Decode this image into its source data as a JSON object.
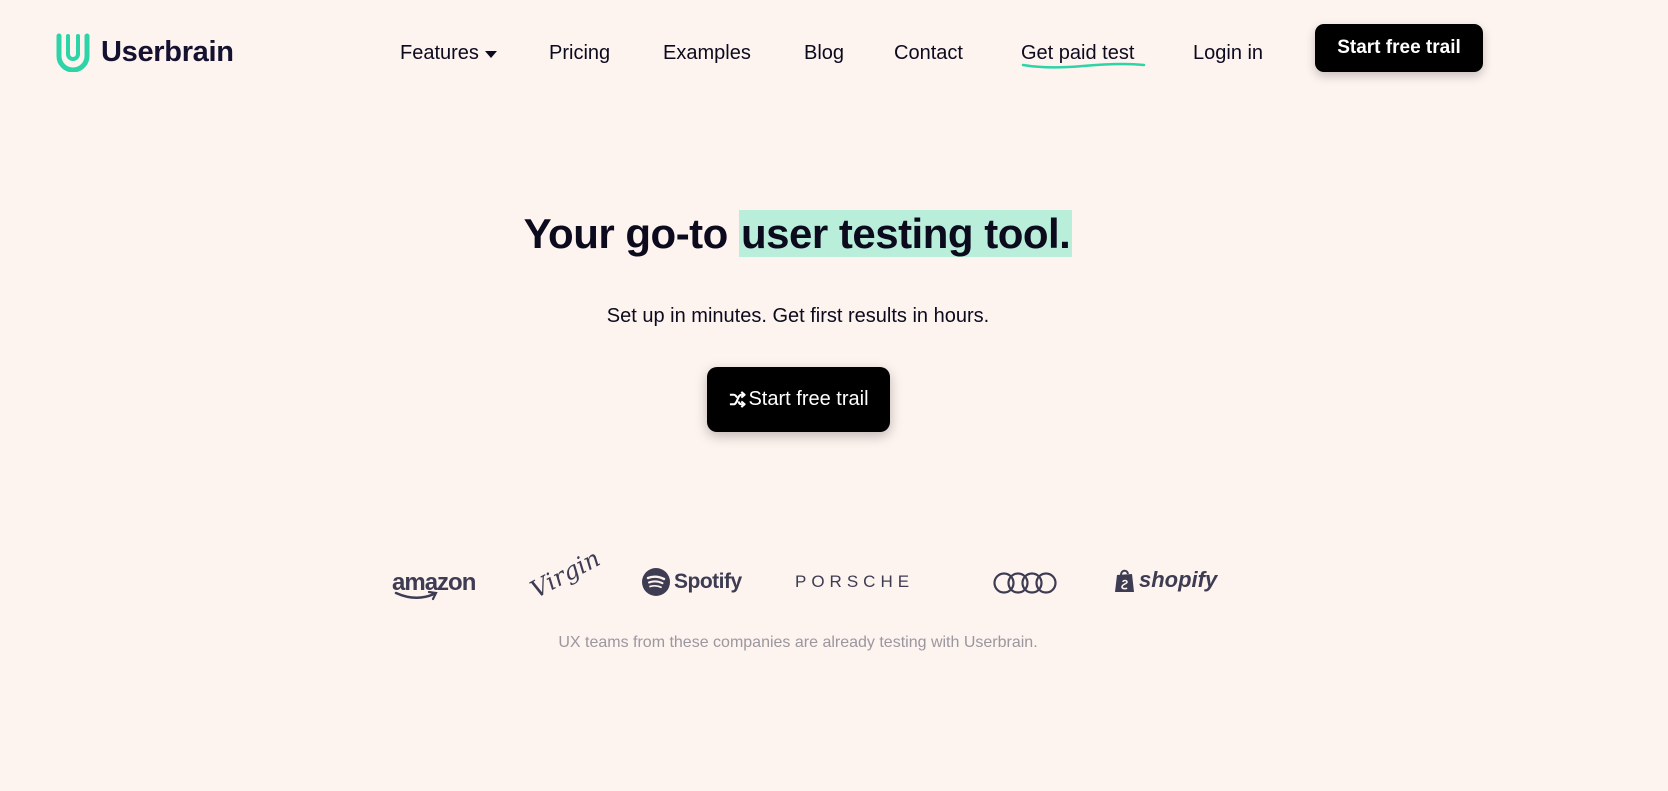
{
  "header": {
    "logo_text": "Userbrain",
    "nav": {
      "features": "Features",
      "pricing": "Pricing",
      "examples": "Examples",
      "blog": "Blog",
      "contact": "Contact",
      "get_paid": "Get paid test",
      "login": "Login in"
    },
    "cta_label": "Start free trail"
  },
  "hero": {
    "title_prefix": "Your go-to ",
    "title_highlight": "user testing tool.",
    "subtitle": "Set up in minutes. Get first results in hours.",
    "cta_label": "Start free trail"
  },
  "logos": {
    "brands": [
      "amazon",
      "Virgin",
      "Spotify",
      "PORSCHE",
      "Audi",
      "shopify"
    ],
    "caption": "UX teams from these companies are already testing with Userbrain."
  },
  "colors": {
    "background": "#fdf3ef",
    "accent": "#2dd4a7",
    "highlight": "#b9eedb",
    "button": "#000000",
    "logo_gray": "#3d3c52"
  }
}
